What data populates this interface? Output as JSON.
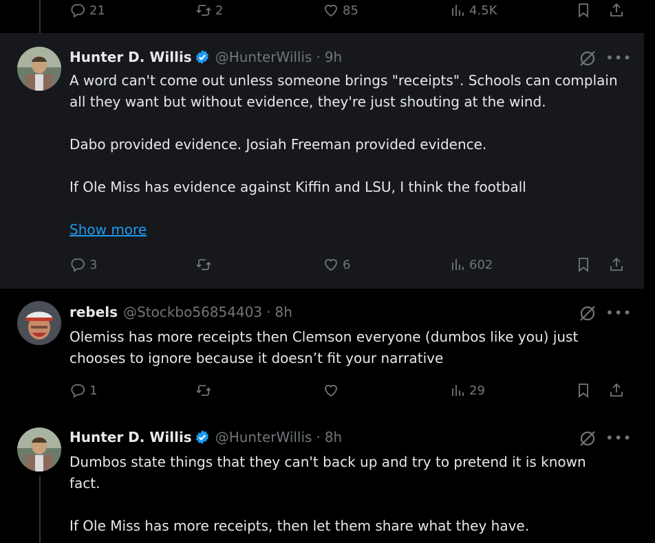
{
  "top_actions": {
    "replies": "21",
    "reposts": "2",
    "likes": "85",
    "views": "4.5K"
  },
  "tweets": [
    {
      "name": "Hunter D. Willis",
      "handle": "@HunterWillis",
      "sep": "·",
      "time": "9h",
      "body": "A word can't come out unless someone brings \"receipts\". Schools can complain all they want but without evidence, they're just shouting at the wind.\n\nDabo provided evidence. Josiah Freeman provided evidence.\n\nIf Ole Miss has evidence against Kiffin and LSU, I think the football",
      "show_more": "Show more",
      "replies": "3",
      "reposts": "",
      "likes": "6",
      "views": "602"
    },
    {
      "name": "rebels",
      "handle": "@Stockbo56854403",
      "sep": "·",
      "time": "8h",
      "body": "Olemiss has more receipts then Clemson everyone (dumbos like you) just chooses to ignore because it doesn’t fit your narrative",
      "replies": "1",
      "reposts": "",
      "likes": "",
      "views": "29"
    },
    {
      "name": "Hunter D. Willis",
      "handle": "@HunterWillis",
      "sep": "·",
      "time": "8h",
      "body": "Dumbos state things that they can't back up and try to pretend it is known fact.\n\nIf Ole Miss has more receipts, then let them share what they have."
    }
  ],
  "colors": {
    "background": "#000000",
    "highlight": "#16181c",
    "text": "#e7e9ea",
    "muted": "#71767b",
    "link": "#1d9bf0",
    "verified": "#1d9bf0"
  }
}
